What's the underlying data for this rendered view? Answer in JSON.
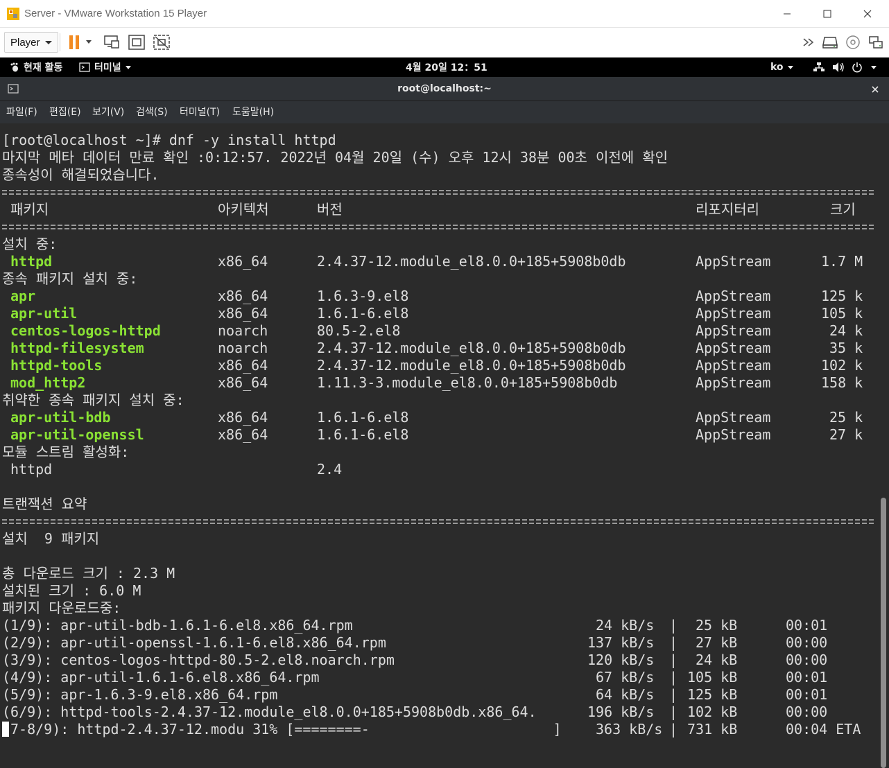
{
  "window": {
    "title": "Server - VMware Workstation 15 Player",
    "controls": [
      "minimize",
      "maximize",
      "close"
    ]
  },
  "toolbar": {
    "player_menu_label": "Player",
    "buttons": [
      "pause-icon",
      "send-ctrl-alt-del-icon",
      "fit-guest-icon",
      "unity-icon"
    ],
    "right_icons": [
      "overflow-chevrons-icon",
      "hard-disk-icon",
      "cd-dvd-icon",
      "network-adapter-icon"
    ]
  },
  "gnome_bar": {
    "activities": "현재 활동",
    "app_menu": "터미널",
    "clock": "4월 20일 12：51",
    "input_method": "ko"
  },
  "terminal": {
    "title": "root@localhost:~",
    "menus": [
      "파일(F)",
      "편집(E)",
      "보기(V)",
      "검색(S)",
      "터미널(T)",
      "도움말(H)"
    ],
    "prompt_line": "[root@localhost ~]# dnf -y install httpd",
    "meta_line": "마지막 메타 데이터 만료 확인 :0:12:57. 2022년 04월 20일 (수) 오후 12시 38분 00초 이전에 확인",
    "resolved_line": "종속성이 해결되었습니다.",
    "table_headers": {
      "package": "패키지",
      "arch": "아키텍처",
      "version": "버전",
      "repository": "리포지터리",
      "size": "크기"
    },
    "groups": [
      {
        "heading": "설치 중:",
        "rows": [
          {
            "name": "httpd",
            "arch": "x86_64",
            "version": "2.4.37-12.module_el8.0.0+185+5908b0db",
            "repo": "AppStream",
            "size": "1.7 M"
          }
        ]
      },
      {
        "heading": "종속 패키지 설치 중:",
        "rows": [
          {
            "name": "apr",
            "arch": "x86_64",
            "version": "1.6.3-9.el8",
            "repo": "AppStream",
            "size": "125 k"
          },
          {
            "name": "apr-util",
            "arch": "x86_64",
            "version": "1.6.1-6.el8",
            "repo": "AppStream",
            "size": "105 k"
          },
          {
            "name": "centos-logos-httpd",
            "arch": "noarch",
            "version": "80.5-2.el8",
            "repo": "AppStream",
            "size": "24 k"
          },
          {
            "name": "httpd-filesystem",
            "arch": "noarch",
            "version": "2.4.37-12.module_el8.0.0+185+5908b0db",
            "repo": "AppStream",
            "size": "35 k"
          },
          {
            "name": "httpd-tools",
            "arch": "x86_64",
            "version": "2.4.37-12.module_el8.0.0+185+5908b0db",
            "repo": "AppStream",
            "size": "102 k"
          },
          {
            "name": "mod_http2",
            "arch": "x86_64",
            "version": "1.11.3-3.module_el8.0.0+185+5908b0db",
            "repo": "AppStream",
            "size": "158 k"
          }
        ]
      },
      {
        "heading": "취약한 종속 패키지 설치 중:",
        "rows": [
          {
            "name": "apr-util-bdb",
            "arch": "x86_64",
            "version": "1.6.1-6.el8",
            "repo": "AppStream",
            "size": "25 k"
          },
          {
            "name": "apr-util-openssl",
            "arch": "x86_64",
            "version": "1.6.1-6.el8",
            "repo": "AppStream",
            "size": "27 k"
          }
        ]
      }
    ],
    "module_heading": "모듈 스트림 활성화:",
    "module_row": {
      "name": "httpd",
      "version": "2.4"
    },
    "summary_heading": "트랜잭션 요약",
    "install_count": "설치  9 패키지",
    "total_download": "총 다운로드 크기 : 2.3 M",
    "installed_size": "설치된 크기 : 6.0 M",
    "downloading_heading": "패키지 다운로드중:",
    "downloads": [
      {
        "label": "(1/9): apr-util-bdb-1.6.1-6.el8.x86_64.rpm",
        "rate": "24 kB/s",
        "size": "25 kB",
        "time": "00:01"
      },
      {
        "label": "(2/9): apr-util-openssl-1.6.1-6.el8.x86_64.rpm",
        "rate": "137 kB/s",
        "size": "27 kB",
        "time": "00:00"
      },
      {
        "label": "(3/9): centos-logos-httpd-80.5-2.el8.noarch.rpm",
        "rate": "120 kB/s",
        "size": "24 kB",
        "time": "00:00"
      },
      {
        "label": "(4/9): apr-util-1.6.1-6.el8.x86_64.rpm",
        "rate": "67 kB/s",
        "size": "105 kB",
        "time": "00:01"
      },
      {
        "label": "(5/9): apr-1.6.3-9.el8.x86_64.rpm",
        "rate": "64 kB/s",
        "size": "125 kB",
        "time": "00:01"
      },
      {
        "label": "(6/9): httpd-tools-2.4.37-12.module_el8.0.0+185+5908b0db.x86_64.",
        "rate": "196 kB/s",
        "size": "102 kB",
        "time": "00:00"
      }
    ],
    "progress": {
      "label": "7-8/9): httpd-2.4.37-12.modu 31% [========-                      ]",
      "rate": "363 kB/s",
      "size": "731 kB",
      "time": "00:04 ETA"
    },
    "column_divider": "|"
  }
}
